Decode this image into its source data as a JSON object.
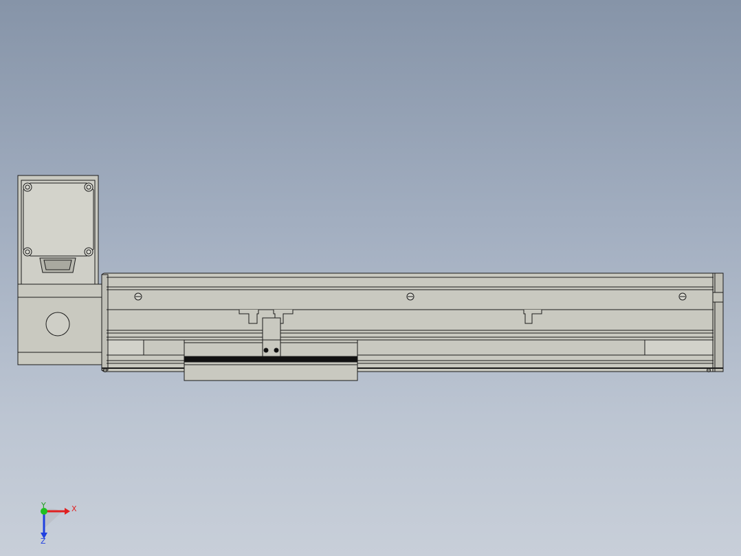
{
  "viewport": {
    "background_top": "#8694a8",
    "background_bottom": "#c8cfd9"
  },
  "model": {
    "part_fill": "#c9c9c0",
    "part_fill_light": "#d6d6ce",
    "edge_color": "#1a1a1a",
    "description_icons": [
      "motor-flange-icon",
      "linear-rail-icon",
      "carriage-icon",
      "screw-head-icon"
    ]
  },
  "triad": {
    "x_label": "X",
    "y_label": "Y",
    "z_label": "Z",
    "x_color": "#e02020",
    "y_color": "#20c020",
    "z_color": "#2040e0"
  }
}
